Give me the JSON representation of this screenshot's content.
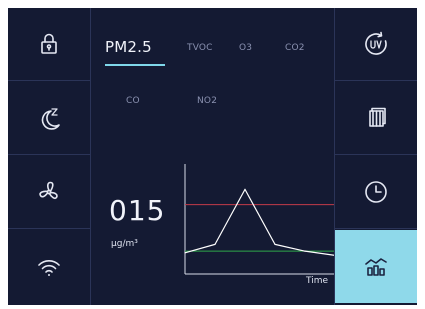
{
  "tabs": [
    {
      "label": "PM2.5",
      "active": true
    },
    {
      "label": "TVOC",
      "active": false
    },
    {
      "label": "O3",
      "active": false
    },
    {
      "label": "CO2",
      "active": false
    },
    {
      "label": "CO",
      "active": false
    },
    {
      "label": "NO2",
      "active": false
    }
  ],
  "reading": {
    "value": "015",
    "unit": "μg/m³"
  },
  "chart_data": {
    "type": "line",
    "xlabel": "Time",
    "ylabel": "",
    "x": [
      0,
      1,
      2,
      3,
      4,
      5
    ],
    "series": [
      {
        "values": [
          25,
          35,
          100,
          35,
          27,
          22
        ],
        "color": "#ffffff"
      }
    ],
    "reference_lines": [
      {
        "value": 82,
        "color": "#c23a4a"
      },
      {
        "value": 27,
        "color": "#2fa84a"
      }
    ],
    "ylim": [
      0,
      130
    ]
  },
  "left_buttons": [
    {
      "icon": "lock-icon"
    },
    {
      "icon": "sleep-moon-icon"
    },
    {
      "icon": "fan-icon"
    },
    {
      "icon": "wifi-icon"
    }
  ],
  "right_buttons": [
    {
      "icon": "uv-icon"
    },
    {
      "icon": "filter-icon"
    },
    {
      "icon": "clock-icon"
    },
    {
      "icon": "chart-icon",
      "active": true
    }
  ],
  "colors": {
    "background": "#141a33",
    "accent": "#8fd9ea",
    "divider": "#2b3458"
  }
}
